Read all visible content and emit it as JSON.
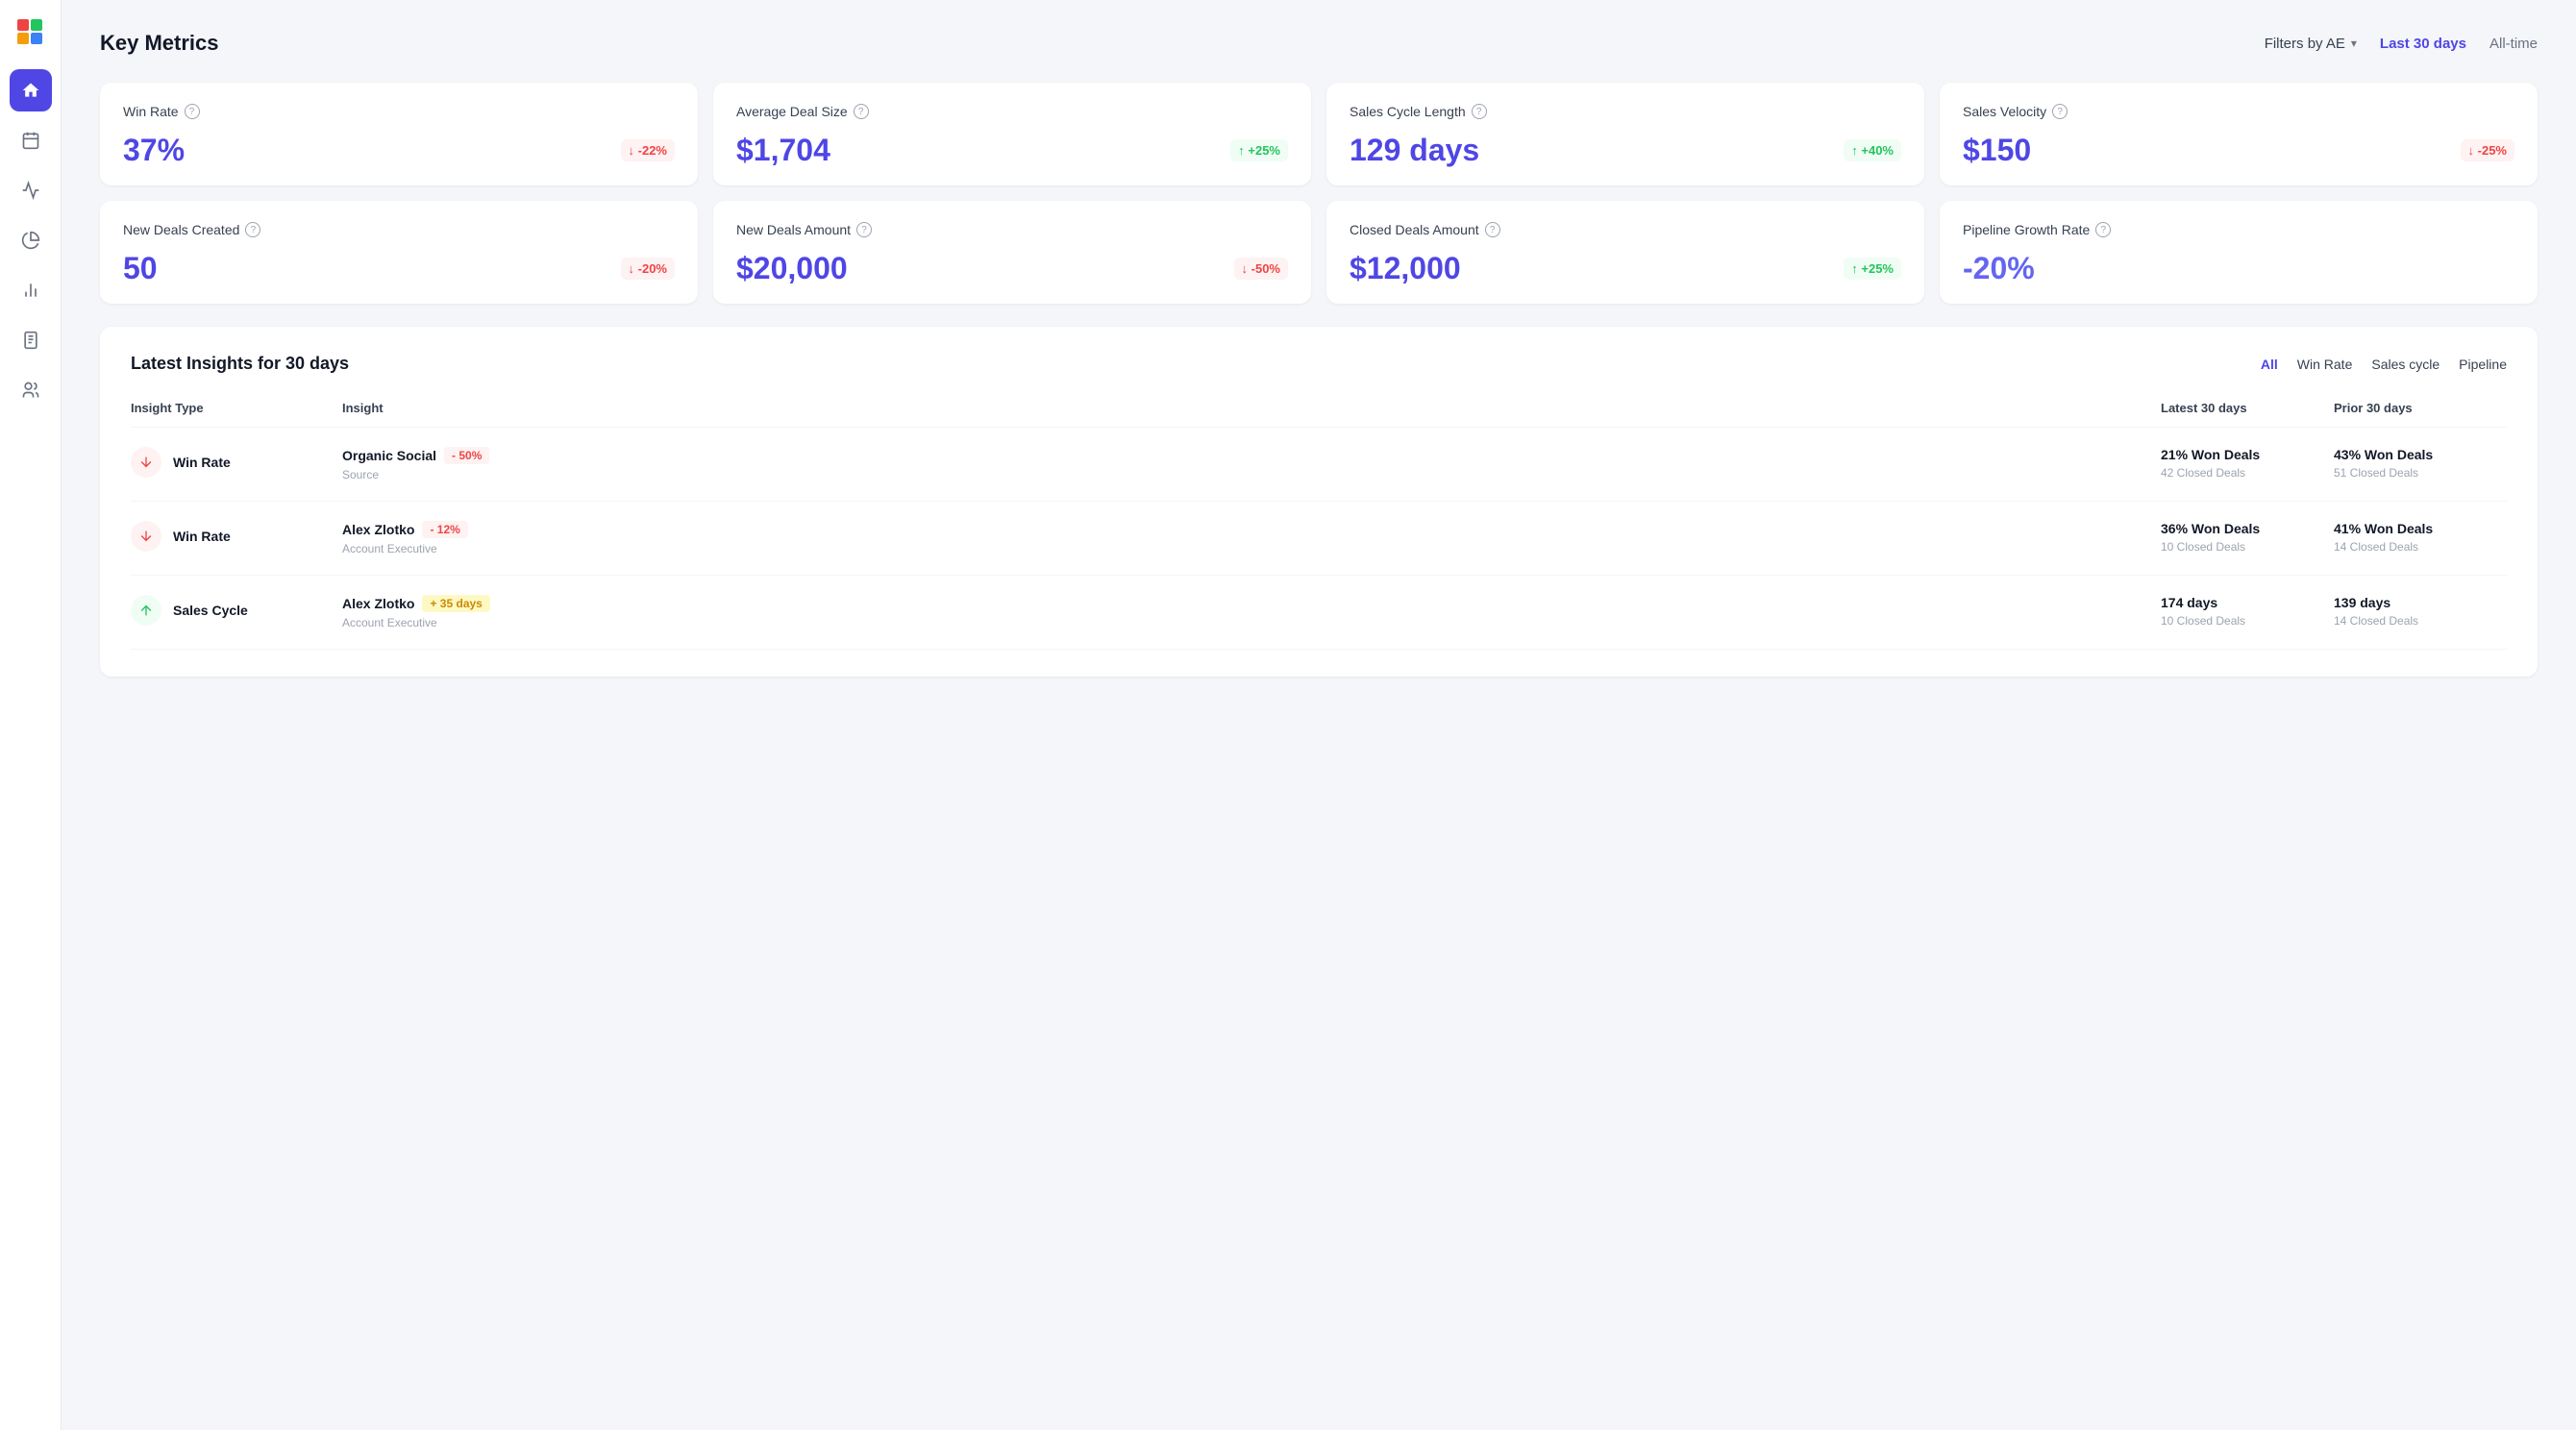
{
  "page": {
    "title": "Key Metrics"
  },
  "header": {
    "filter_label": "Filters by AE",
    "time_last30": "Last 30 days",
    "time_alltime": "All-time",
    "active_time": "last30"
  },
  "metrics": [
    {
      "id": "win-rate",
      "label": "Win Rate",
      "value": "37%",
      "change": "-22%",
      "direction": "down"
    },
    {
      "id": "avg-deal-size",
      "label": "Average Deal Size",
      "value": "$1,704",
      "change": "+25%",
      "direction": "up"
    },
    {
      "id": "sales-cycle-length",
      "label": "Sales Cycle Length",
      "value": "129 days",
      "change": "+40%",
      "direction": "up"
    },
    {
      "id": "sales-velocity",
      "label": "Sales Velocity",
      "value": "$150",
      "change": "-25%",
      "direction": "down"
    },
    {
      "id": "new-deals-created",
      "label": "New Deals Created",
      "value": "50",
      "change": "-20%",
      "direction": "down"
    },
    {
      "id": "new-deals-amount",
      "label": "New Deals Amount",
      "value": "$20,000",
      "change": "-50%",
      "direction": "down"
    },
    {
      "id": "closed-deals-amount",
      "label": "Closed Deals Amount",
      "value": "$12,000",
      "change": "+25%",
      "direction": "up"
    },
    {
      "id": "pipeline-growth-rate",
      "label": "Pipeline Growth Rate",
      "value": "-20%",
      "change": null,
      "direction": null
    }
  ],
  "insights": {
    "section_title": "Latest Insights for 30 days",
    "filter_all": "All",
    "filter_winrate": "Win Rate",
    "filter_salescycle": "Sales cycle",
    "filter_pipeline": "Pipeline",
    "active_filter": "all",
    "table": {
      "col_type": "Insight Type",
      "col_insight": "Insight",
      "col_latest": "Latest 30 days",
      "col_prior": "Prior 30 days"
    },
    "rows": [
      {
        "id": "row1",
        "type": "Win Rate",
        "direction": "down",
        "insight_name": "Organic Social",
        "insight_badge": "- 50%",
        "badge_type": "negative",
        "insight_sub": "Source",
        "latest_primary": "21% Won Deals",
        "latest_sub": "42 Closed Deals",
        "prior_primary": "43% Won Deals",
        "prior_sub": "51 Closed Deals"
      },
      {
        "id": "row2",
        "type": "Win Rate",
        "direction": "down",
        "insight_name": "Alex Zlotko",
        "insight_badge": "- 12%",
        "badge_type": "negative",
        "insight_sub": "Account Executive",
        "latest_primary": "36% Won Deals",
        "latest_sub": "10 Closed Deals",
        "prior_primary": "41% Won Deals",
        "prior_sub": "14 Closed Deals"
      },
      {
        "id": "row3",
        "type": "Sales Cycle",
        "direction": "up",
        "insight_name": "Alex Zlotko",
        "insight_badge": "+ 35 days",
        "badge_type": "neutral-pos",
        "insight_sub": "Account Executive",
        "latest_primary": "174 days",
        "latest_sub": "10 Closed Deals",
        "prior_primary": "139 days",
        "prior_sub": "14 Closed Deals"
      }
    ]
  },
  "sidebar": {
    "nav_items": [
      {
        "id": "home",
        "label": "Home",
        "active": true
      },
      {
        "id": "calendar",
        "label": "Calendar",
        "active": false
      },
      {
        "id": "chart-line",
        "label": "Reports",
        "active": false
      },
      {
        "id": "pie-chart",
        "label": "Analytics",
        "active": false
      },
      {
        "id": "bar-chart",
        "label": "Metrics",
        "active": false
      },
      {
        "id": "clipboard",
        "label": "Tasks",
        "active": false
      },
      {
        "id": "team",
        "label": "Team",
        "active": false
      }
    ]
  }
}
